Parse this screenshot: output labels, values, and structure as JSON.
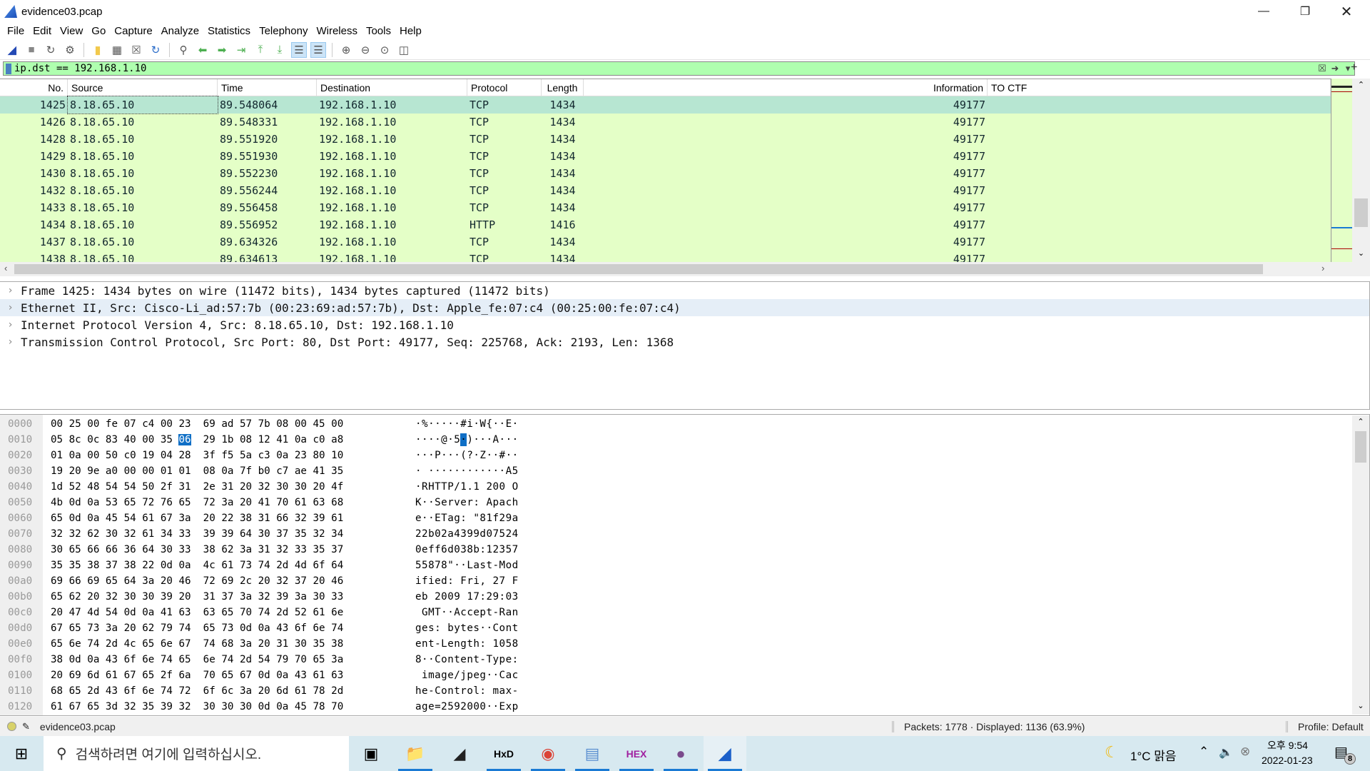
{
  "window": {
    "title": "evidence03.pcap"
  },
  "menu": [
    "File",
    "Edit",
    "View",
    "Go",
    "Capture",
    "Analyze",
    "Statistics",
    "Telephony",
    "Wireless",
    "Tools",
    "Help"
  ],
  "toolbar": [
    "start-capture-icon",
    "stop-capture-icon",
    "restart-capture-icon",
    "capture-options-icon",
    "open-file-icon",
    "save-file-icon",
    "close-file-icon",
    "reload-file-icon",
    "find-packet-icon",
    "go-back-icon",
    "go-forward-icon",
    "go-to-packet-icon",
    "first-packet-icon",
    "last-packet-icon",
    "autoscroll-icon",
    "colorize-icon",
    "zoom-in-icon",
    "zoom-out-icon",
    "zoom-normal-icon",
    "resize-columns-icon"
  ],
  "filter": {
    "value": "ip.dst == 192.168.1.10",
    "bg": "#afffaf"
  },
  "columns": [
    "No.",
    "Source",
    "Time",
    "Destination",
    "Protocol",
    "Length",
    "Information",
    "TO CTF"
  ],
  "packets": [
    [
      "1425",
      "8.18.65.10",
      "89.548064",
      "192.168.1.10",
      "TCP",
      "1434",
      "49177",
      ""
    ],
    [
      "1426",
      "8.18.65.10",
      "89.548331",
      "192.168.1.10",
      "TCP",
      "1434",
      "49177",
      ""
    ],
    [
      "1428",
      "8.18.65.10",
      "89.551920",
      "192.168.1.10",
      "TCP",
      "1434",
      "49177",
      ""
    ],
    [
      "1429",
      "8.18.65.10",
      "89.551930",
      "192.168.1.10",
      "TCP",
      "1434",
      "49177",
      ""
    ],
    [
      "1430",
      "8.18.65.10",
      "89.552230",
      "192.168.1.10",
      "TCP",
      "1434",
      "49177",
      ""
    ],
    [
      "1432",
      "8.18.65.10",
      "89.556244",
      "192.168.1.10",
      "TCP",
      "1434",
      "49177",
      ""
    ],
    [
      "1433",
      "8.18.65.10",
      "89.556458",
      "192.168.1.10",
      "TCP",
      "1434",
      "49177",
      ""
    ],
    [
      "1434",
      "8.18.65.10",
      "89.556952",
      "192.168.1.10",
      "HTTP",
      "1416",
      "49177",
      ""
    ],
    [
      "1437",
      "8.18.65.10",
      "89.634326",
      "192.168.1.10",
      "TCP",
      "1434",
      "49177",
      ""
    ],
    [
      "1438",
      "8.18.65.10",
      "89.634613",
      "192.168.1.10",
      "TCP",
      "1434",
      "49177",
      ""
    ]
  ],
  "selected_packet": "1425",
  "row_colors": {
    "tcp": "#e4ffc7",
    "selected": "#b7e6d2"
  },
  "details": [
    "Frame 1425: 1434 bytes on wire (11472 bits), 1434 bytes captured (11472 bits)",
    "Ethernet II, Src: Cisco-Li_ad:57:7b (00:23:69:ad:57:7b), Dst: Apple_fe:07:c4 (00:25:00:fe:07:c4)",
    "Internet Protocol Version 4, Src: 8.18.65.10, Dst: 192.168.1.10",
    "Transmission Control Protocol, Src Port: 80, Dst Port: 49177, Seq: 225768, Ack: 2193, Len: 1368"
  ],
  "hex_selected": {
    "row": 1,
    "byte": 7
  },
  "hex": [
    {
      "off": "0000",
      "bytes": "00 25 00 fe 07 c4 00 23 69 ad 57 7b 08 00 45 00",
      "ascii": "·%·····#i·W{··E·"
    },
    {
      "off": "0010",
      "bytes": "05 8c 0c 83 40 00 35 06 29 1b 08 12 41 0a c0 a8",
      "ascii": "····@·5·)···A···"
    },
    {
      "off": "0020",
      "bytes": "01 0a 00 50 c0 19 04 28 3f f5 5a c3 0a 23 80 10",
      "ascii": "···P···(?·Z··#··"
    },
    {
      "off": "0030",
      "bytes": "19 20 9e a0 00 00 01 01 08 0a 7f b0 c7 ae 41 35",
      "ascii": "· ············A5"
    },
    {
      "off": "0040",
      "bytes": "1d 52 48 54 54 50 2f 31 2e 31 20 32 30 30 20 4f",
      "ascii": "·RHTTP/1.1 200 O"
    },
    {
      "off": "0050",
      "bytes": "4b 0d 0a 53 65 72 76 65 72 3a 20 41 70 61 63 68",
      "ascii": "K··Server: Apach"
    },
    {
      "off": "0060",
      "bytes": "65 0d 0a 45 54 61 67 3a 20 22 38 31 66 32 39 61",
      "ascii": "e··ETag: \"81f29a"
    },
    {
      "off": "0070",
      "bytes": "32 32 62 30 32 61 34 33 39 39 64 30 37 35 32 34",
      "ascii": "22b02a4399d07524"
    },
    {
      "off": "0080",
      "bytes": "30 65 66 66 36 64 30 33 38 62 3a 31 32 33 35 37",
      "ascii": "0eff6d038b:12357"
    },
    {
      "off": "0090",
      "bytes": "35 35 38 37 38 22 0d 0a 4c 61 73 74 2d 4d 6f 64",
      "ascii": "55878\"··Last-Mod"
    },
    {
      "off": "00a0",
      "bytes": "69 66 69 65 64 3a 20 46 72 69 2c 20 32 37 20 46",
      "ascii": "ified: Fri, 27 F"
    },
    {
      "off": "00b0",
      "bytes": "65 62 20 32 30 30 39 20 31 37 3a 32 39 3a 30 33",
      "ascii": "eb 2009 17:29:03"
    },
    {
      "off": "00c0",
      "bytes": "20 47 4d 54 0d 0a 41 63 63 65 70 74 2d 52 61 6e",
      "ascii": " GMT··Accept-Ran"
    },
    {
      "off": "00d0",
      "bytes": "67 65 73 3a 20 62 79 74 65 73 0d 0a 43 6f 6e 74",
      "ascii": "ges: bytes··Cont"
    },
    {
      "off": "00e0",
      "bytes": "65 6e 74 2d 4c 65 6e 67 74 68 3a 20 31 30 35 38",
      "ascii": "ent-Length: 1058"
    },
    {
      "off": "00f0",
      "bytes": "38 0d 0a 43 6f 6e 74 65 6e 74 2d 54 79 70 65 3a",
      "ascii": "8··Content-Type:"
    },
    {
      "off": "0100",
      "bytes": "20 69 6d 61 67 65 2f 6a 70 65 67 0d 0a 43 61 63",
      "ascii": " image/jpeg··Cac"
    },
    {
      "off": "0110",
      "bytes": "68 65 2d 43 6f 6e 74 72 6f 6c 3a 20 6d 61 78 2d",
      "ascii": "he-Control: max-"
    },
    {
      "off": "0120",
      "bytes": "61 67 65 3d 32 35 39 32 30 30 30 0d 0a 45 78 70",
      "ascii": "age=2592000··Exp"
    }
  ],
  "status": {
    "file": "evidence03.pcap",
    "packets": "Packets: 1778 · Displayed: 1136 (63.9%)",
    "profile": "Profile: Default"
  },
  "taskbar": {
    "search_placeholder": "검색하려면 여기에 입력하십시오.",
    "apps": [
      "task-view-icon",
      "file-explorer-icon",
      "sticky-notes-icon",
      "hxd-icon",
      "chrome-icon",
      "notepad-icon",
      "hex-workshop-icon",
      "kali-icon",
      "wireshark-icon"
    ],
    "weather": "1°C 맑음",
    "time": "오후 9:54",
    "date": "2022-01-23",
    "notifications": "8"
  }
}
